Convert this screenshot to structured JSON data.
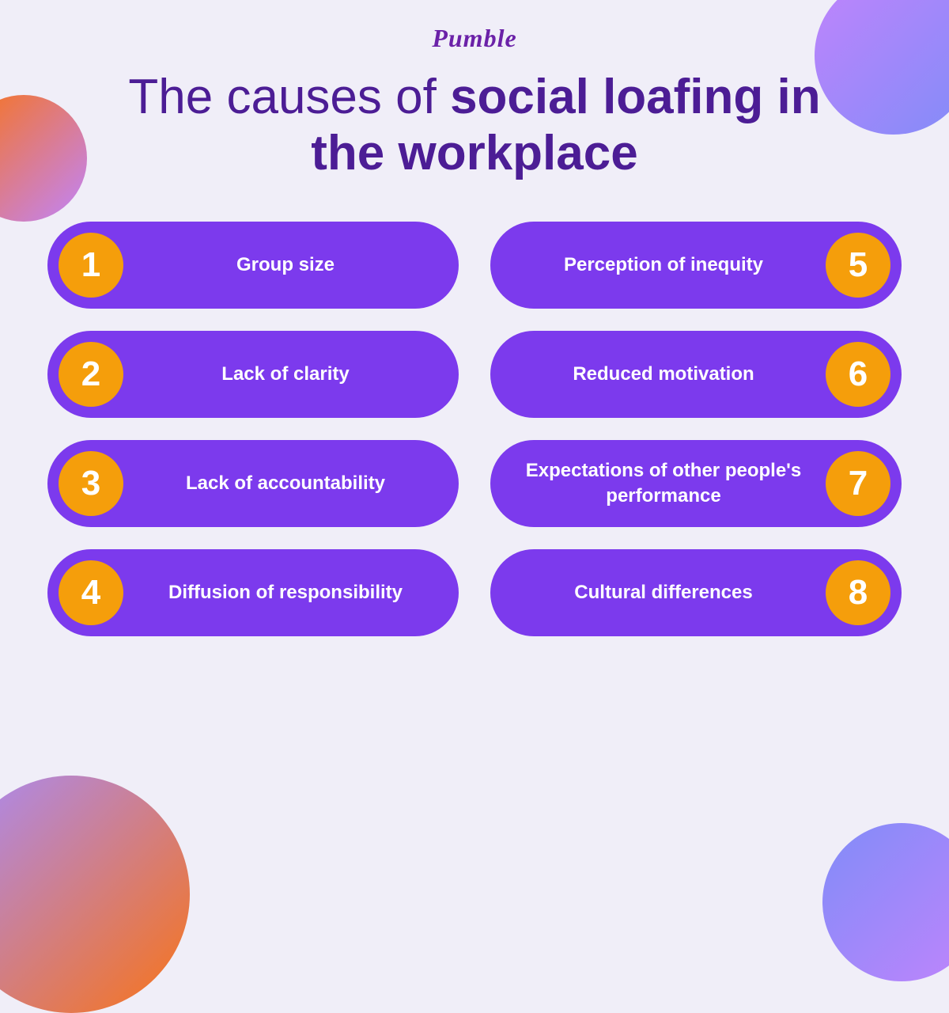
{
  "logo": "Pumble",
  "title": {
    "normal": "The causes of ",
    "bold": "social loafing in the workplace"
  },
  "cards": [
    {
      "id": "1",
      "label": "Group size",
      "side": "left"
    },
    {
      "id": "5",
      "label": "Perception of inequity",
      "side": "right"
    },
    {
      "id": "2",
      "label": "Lack of clarity",
      "side": "left"
    },
    {
      "id": "6",
      "label": "Reduced motivation",
      "side": "right"
    },
    {
      "id": "3",
      "label": "Lack of accountability",
      "side": "left"
    },
    {
      "id": "7",
      "label": "Expectations of other people's performance",
      "side": "right"
    },
    {
      "id": "4",
      "label": "Diffusion of responsibility",
      "side": "left"
    },
    {
      "id": "8",
      "label": "Cultural differences",
      "side": "right"
    }
  ]
}
